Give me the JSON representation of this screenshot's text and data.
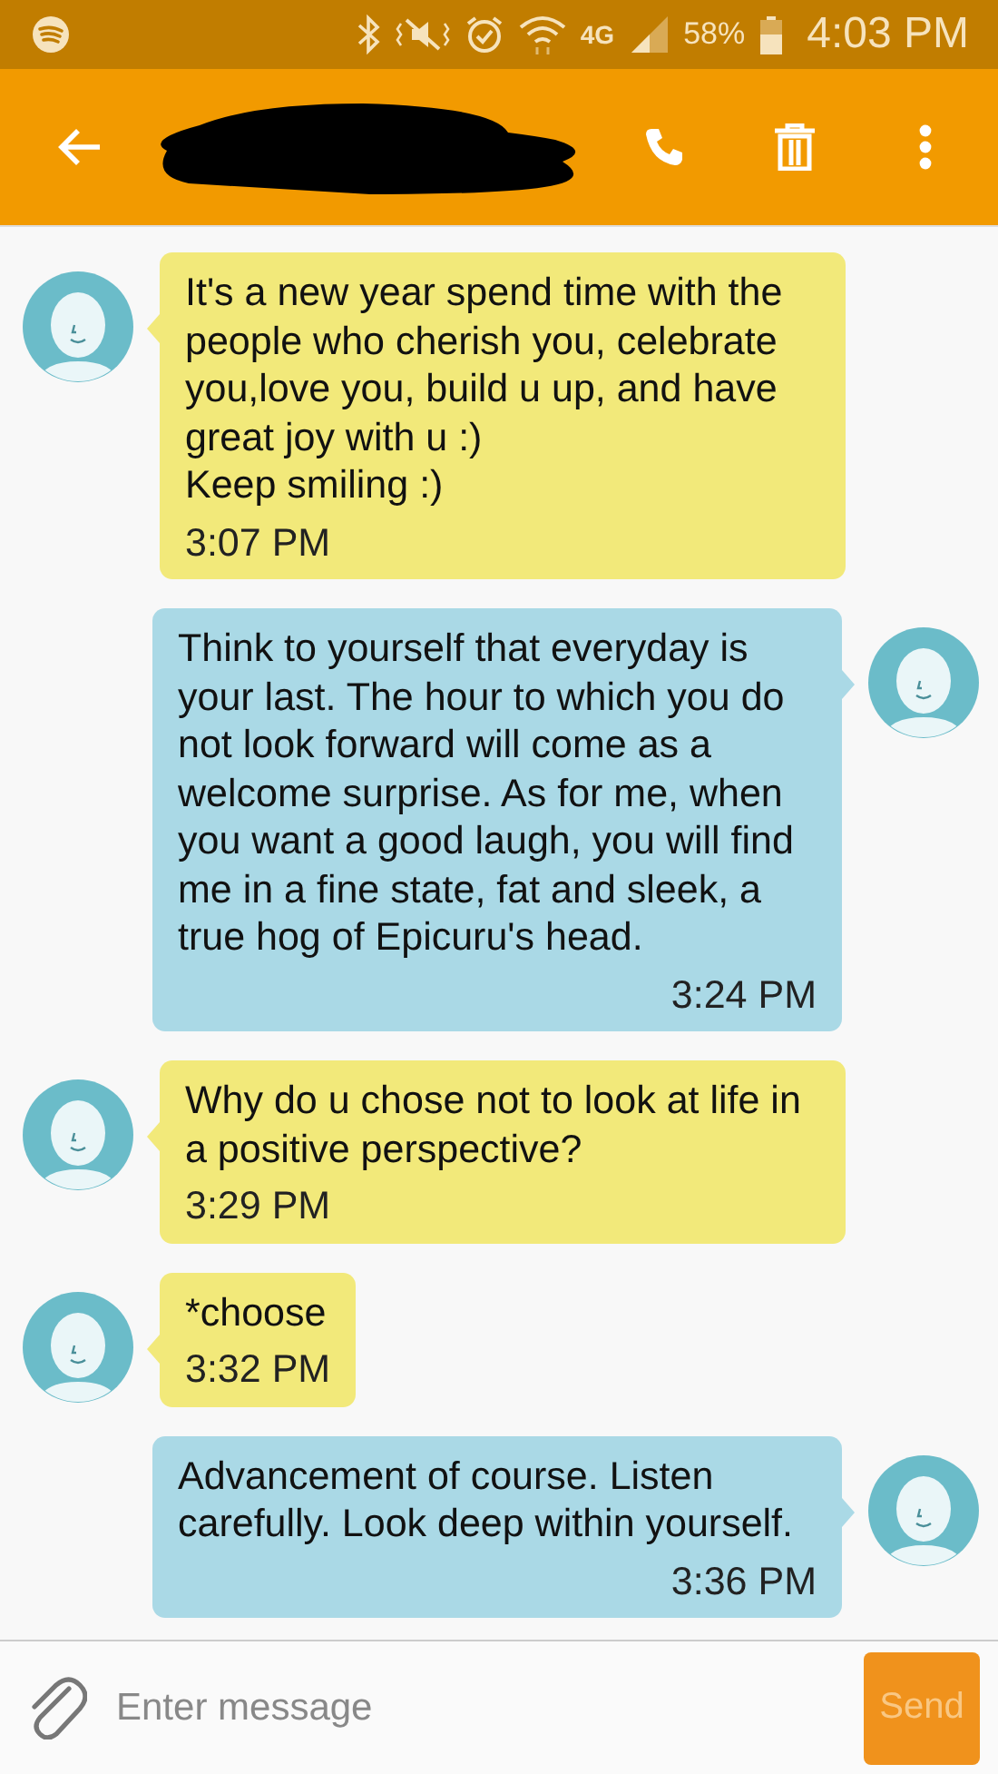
{
  "status_bar": {
    "network_type": "4G",
    "battery": "58%",
    "time": "4:03 PM"
  },
  "messages": [
    {
      "kind": "incoming",
      "text": "It's a new year spend time with the people who cherish you, celebrate you,love you, build u up, and have great joy with u :)\nKeep smiling :)",
      "time": "3:07 PM"
    },
    {
      "kind": "outgoing",
      "text": "Think to yourself that everyday is your last. The hour to which you do not look forward will come as a welcome surprise. As for me, when you want a good laugh, you will find me in a fine state, fat and sleek, a true hog of Epicuru's head.",
      "time": "3:24 PM"
    },
    {
      "kind": "incoming",
      "text": "Why do u chose not to look at life in a positive perspective?",
      "time": "3:29 PM"
    },
    {
      "kind": "incoming",
      "text": "*choose",
      "time": "3:32 PM"
    },
    {
      "kind": "outgoing",
      "text": "Advancement of course. Listen carefully. Look deep within yourself.",
      "time": "3:36 PM"
    }
  ],
  "composer": {
    "placeholder": "Enter message",
    "send": "Send"
  }
}
